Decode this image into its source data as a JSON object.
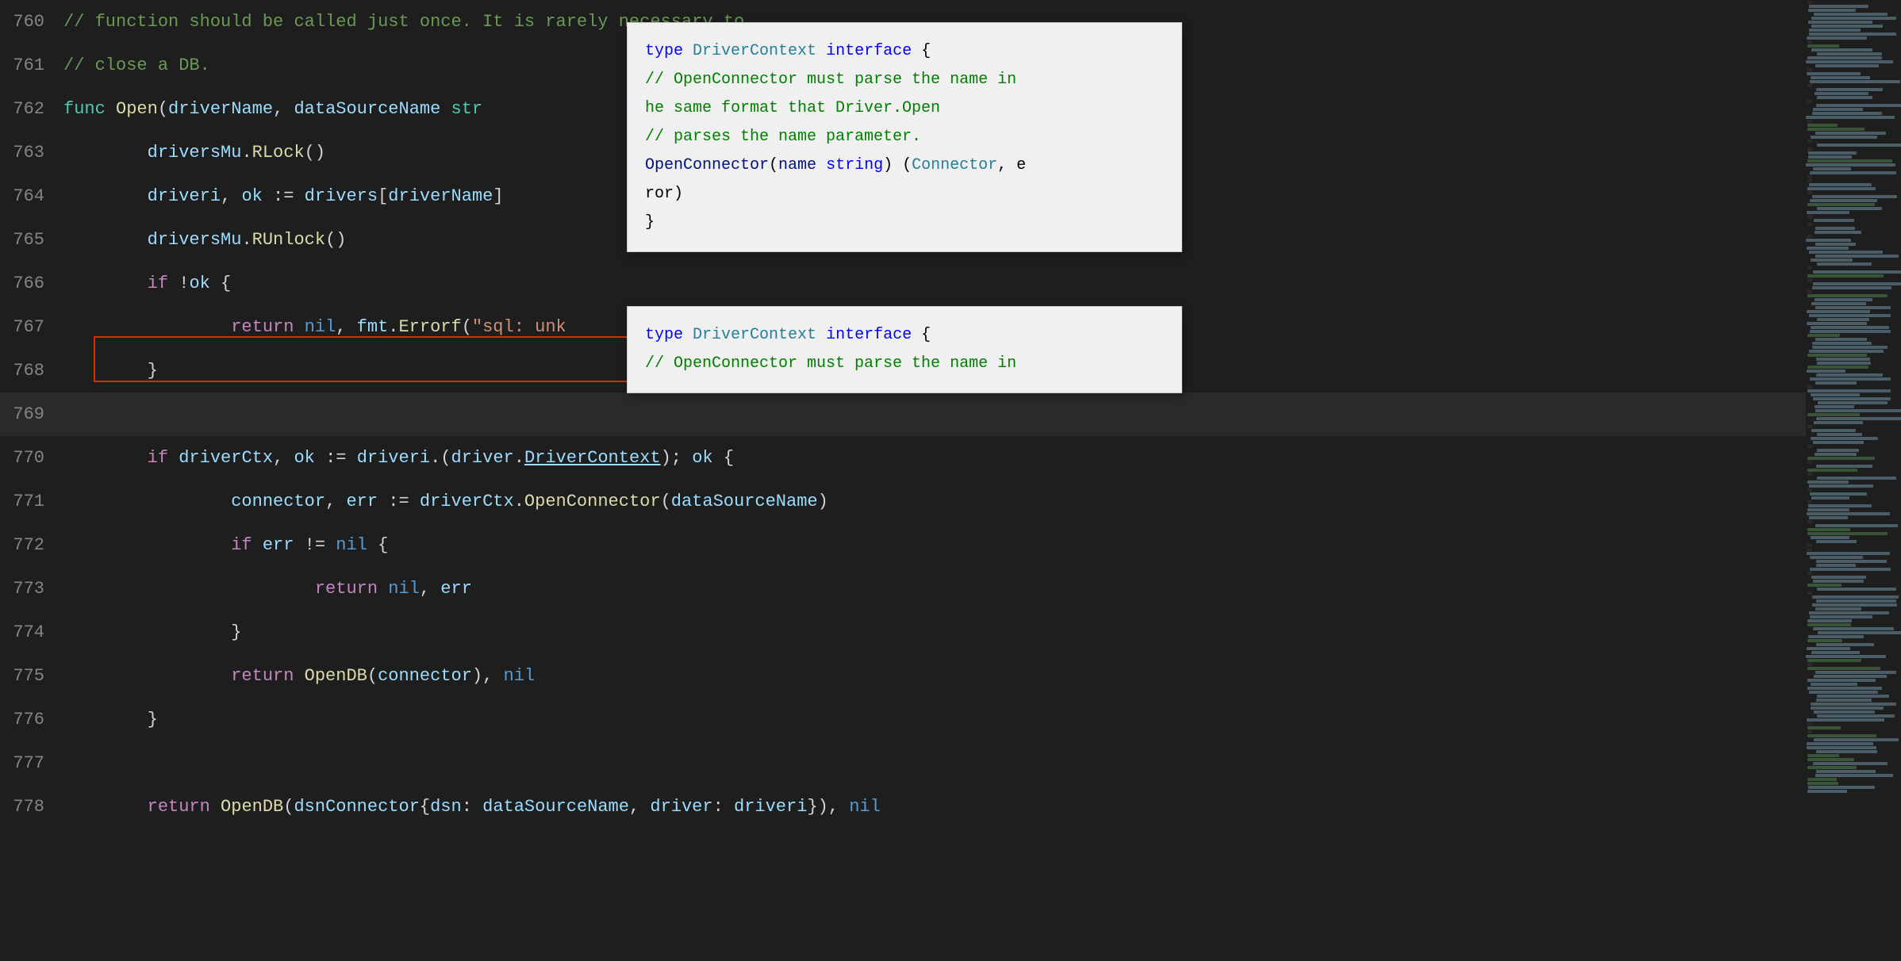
{
  "lines": [
    {
      "num": "760",
      "tokens": [
        {
          "type": "comment",
          "text": "// function should be called just once. It is rarely necessary to"
        }
      ]
    },
    {
      "num": "761",
      "tokens": [
        {
          "type": "comment",
          "text": "// close a DB."
        }
      ]
    },
    {
      "num": "762",
      "tokens": [
        {
          "type": "kw",
          "text": "func "
        },
        {
          "type": "fn",
          "text": "Open"
        },
        {
          "type": "plain",
          "text": "("
        },
        {
          "type": "ident-blue",
          "text": "driverName"
        },
        {
          "type": "plain",
          "text": ", "
        },
        {
          "type": "ident-blue",
          "text": "dataSourceName"
        },
        {
          "type": "plain",
          "text": " "
        },
        {
          "type": "type",
          "text": "str"
        }
      ]
    },
    {
      "num": "763",
      "tokens": [
        {
          "type": "plain",
          "text": "\t"
        },
        {
          "type": "ident-blue",
          "text": "driversMu"
        },
        {
          "type": "plain",
          "text": "."
        },
        {
          "type": "fn",
          "text": "RLock"
        },
        {
          "type": "plain",
          "text": "()"
        }
      ]
    },
    {
      "num": "764",
      "tokens": [
        {
          "type": "plain",
          "text": "\t"
        },
        {
          "type": "ident-blue",
          "text": "driveri"
        },
        {
          "type": "plain",
          "text": ", "
        },
        {
          "type": "ident-blue",
          "text": "ok"
        },
        {
          "type": "plain",
          "text": " := "
        },
        {
          "type": "ident-blue",
          "text": "drivers"
        },
        {
          "type": "plain",
          "text": "["
        },
        {
          "type": "ident-blue",
          "text": "driverName"
        },
        {
          "type": "plain",
          "text": "]"
        }
      ]
    },
    {
      "num": "765",
      "tokens": [
        {
          "type": "plain",
          "text": "\t"
        },
        {
          "type": "ident-blue",
          "text": "driversMu"
        },
        {
          "type": "plain",
          "text": "."
        },
        {
          "type": "fn",
          "text": "RUnlock"
        },
        {
          "type": "plain",
          "text": "()"
        }
      ]
    },
    {
      "num": "766",
      "tokens": [
        {
          "type": "plain",
          "text": "\t"
        },
        {
          "type": "kw-purple",
          "text": "if"
        },
        {
          "type": "plain",
          "text": " !"
        },
        {
          "type": "ident-blue",
          "text": "ok"
        },
        {
          "type": "plain",
          "text": " {"
        }
      ]
    },
    {
      "num": "767",
      "tokens": [
        {
          "type": "plain",
          "text": "\t\t"
        },
        {
          "type": "kw-purple",
          "text": "return"
        },
        {
          "type": "plain",
          "text": " "
        },
        {
          "type": "kw-blue",
          "text": "nil"
        },
        {
          "type": "plain",
          "text": ", "
        },
        {
          "type": "ident-blue",
          "text": "fmt"
        },
        {
          "type": "plain",
          "text": "."
        },
        {
          "type": "fn",
          "text": "Errorf"
        },
        {
          "type": "plain",
          "text": "("
        },
        {
          "type": "str",
          "text": "\"sql: unk"
        }
      ]
    },
    {
      "num": "768",
      "tokens": [
        {
          "type": "plain",
          "text": "\t}"
        }
      ]
    },
    {
      "num": "769",
      "tokens": []
    },
    {
      "num": "770",
      "tokens": [
        {
          "type": "plain",
          "text": "\t"
        },
        {
          "type": "kw-purple",
          "text": "if"
        },
        {
          "type": "plain",
          "text": " "
        },
        {
          "type": "ident-blue",
          "text": "driverCtx"
        },
        {
          "type": "plain",
          "text": ", "
        },
        {
          "type": "ident-blue",
          "text": "ok"
        },
        {
          "type": "plain",
          "text": " := "
        },
        {
          "type": "ident-blue",
          "text": "driveri"
        },
        {
          "type": "plain",
          "text": ".("
        },
        {
          "type": "ident-blue",
          "text": "driver"
        },
        {
          "type": "plain",
          "text": "."
        },
        {
          "type": "link",
          "text": "DriverContext"
        },
        {
          "type": "plain",
          "text": "); "
        },
        {
          "type": "ident-blue",
          "text": "ok"
        },
        {
          "type": "plain",
          "text": " {"
        }
      ]
    },
    {
      "num": "771",
      "tokens": [
        {
          "type": "plain",
          "text": "\t\t"
        },
        {
          "type": "ident-blue",
          "text": "connector"
        },
        {
          "type": "plain",
          "text": ", "
        },
        {
          "type": "ident-blue",
          "text": "err"
        },
        {
          "type": "plain",
          "text": " := "
        },
        {
          "type": "ident-blue",
          "text": "driverCtx"
        },
        {
          "type": "plain",
          "text": "."
        },
        {
          "type": "fn",
          "text": "OpenConnector"
        },
        {
          "type": "plain",
          "text": "("
        },
        {
          "type": "ident-blue",
          "text": "dataSourceName"
        },
        {
          "type": "plain",
          "text": ")"
        }
      ]
    },
    {
      "num": "772",
      "tokens": [
        {
          "type": "plain",
          "text": "\t\t"
        },
        {
          "type": "kw-purple",
          "text": "if"
        },
        {
          "type": "plain",
          "text": " "
        },
        {
          "type": "ident-blue",
          "text": "err"
        },
        {
          "type": "plain",
          "text": " != "
        },
        {
          "type": "kw-blue",
          "text": "nil"
        },
        {
          "type": "plain",
          "text": " {"
        }
      ]
    },
    {
      "num": "773",
      "tokens": [
        {
          "type": "plain",
          "text": "\t\t\t"
        },
        {
          "type": "kw-purple",
          "text": "return"
        },
        {
          "type": "plain",
          "text": " "
        },
        {
          "type": "kw-blue",
          "text": "nil"
        },
        {
          "type": "plain",
          "text": ", "
        },
        {
          "type": "ident-blue",
          "text": "err"
        }
      ]
    },
    {
      "num": "774",
      "tokens": [
        {
          "type": "plain",
          "text": "\t\t}"
        }
      ]
    },
    {
      "num": "775",
      "tokens": [
        {
          "type": "plain",
          "text": "\t\t"
        },
        {
          "type": "kw-purple",
          "text": "return"
        },
        {
          "type": "plain",
          "text": " "
        },
        {
          "type": "fn",
          "text": "OpenDB"
        },
        {
          "type": "plain",
          "text": "("
        },
        {
          "type": "ident-blue",
          "text": "connector"
        },
        {
          "type": "plain",
          "text": "), "
        },
        {
          "type": "kw-blue",
          "text": "nil"
        }
      ]
    },
    {
      "num": "776",
      "tokens": [
        {
          "type": "plain",
          "text": "\t}"
        }
      ]
    },
    {
      "num": "777",
      "tokens": []
    },
    {
      "num": "778",
      "tokens": [
        {
          "type": "plain",
          "text": "\t"
        },
        {
          "type": "kw-purple",
          "text": "return"
        },
        {
          "type": "plain",
          "text": " "
        },
        {
          "type": "fn",
          "text": "OpenDB"
        },
        {
          "type": "plain",
          "text": "("
        },
        {
          "type": "ident-blue",
          "text": "dsnConnector"
        },
        {
          "type": "plain",
          "text": "{"
        },
        {
          "type": "ident-blue",
          "text": "dsn"
        },
        {
          "type": "plain",
          "text": ": "
        },
        {
          "type": "ident-blue",
          "text": "dataSourceName"
        },
        {
          "type": "plain",
          "text": ", "
        },
        {
          "type": "ident-blue",
          "text": "driver"
        },
        {
          "type": "plain",
          "text": ": "
        },
        {
          "type": "ident-blue",
          "text": "driveri"
        },
        {
          "type": "plain",
          "text": "}), "
        },
        {
          "type": "kw-blue",
          "text": "nil"
        }
      ]
    }
  ],
  "popup1": {
    "lines": [
      {
        "parts": [
          {
            "type": "hp-kw-blue",
            "text": "type "
          },
          {
            "type": "hp-type",
            "text": "DriverContext"
          },
          {
            "type": "hp-plain",
            "text": " "
          },
          {
            "type": "hp-kw-blue",
            "text": "interface"
          },
          {
            "type": "hp-plain",
            "text": " {"
          }
        ]
      },
      {
        "parts": [
          {
            "type": "hp-comment",
            "text": "    // OpenConnector must parse the name in"
          }
        ]
      },
      {
        "parts": [
          {
            "type": "hp-comment",
            "text": "he same format that Driver.Open"
          }
        ]
      },
      {
        "parts": [
          {
            "type": "hp-comment",
            "text": "    // parses the name parameter."
          }
        ]
      },
      {
        "parts": [
          {
            "type": "hp-plain",
            "text": "    "
          },
          {
            "type": "hp-ident",
            "text": "OpenConnector"
          },
          {
            "type": "hp-plain",
            "text": "("
          },
          {
            "type": "hp-ident",
            "text": "name"
          },
          {
            "type": "hp-plain",
            "text": " "
          },
          {
            "type": "hp-kw-blue",
            "text": "string"
          },
          {
            "type": "hp-plain",
            "text": ") ("
          },
          {
            "type": "hp-type",
            "text": "Connector"
          },
          {
            "type": "hp-plain",
            "text": ", e"
          }
        ]
      },
      {
        "parts": [
          {
            "type": "hp-plain",
            "text": "ror)"
          }
        ]
      },
      {
        "parts": [
          {
            "type": "hp-plain",
            "text": "}"
          }
        ]
      }
    ]
  },
  "popup2": {
    "lines": [
      {
        "parts": [
          {
            "type": "hp-kw-blue",
            "text": "type "
          },
          {
            "type": "hp-type",
            "text": "DriverContext"
          },
          {
            "type": "hp-plain",
            "text": " "
          },
          {
            "type": "hp-kw-blue",
            "text": "interface"
          },
          {
            "type": "hp-plain",
            "text": " {"
          }
        ]
      },
      {
        "parts": [
          {
            "type": "hp-comment",
            "text": "    // OpenConnector must parse the name in"
          }
        ]
      }
    ]
  }
}
